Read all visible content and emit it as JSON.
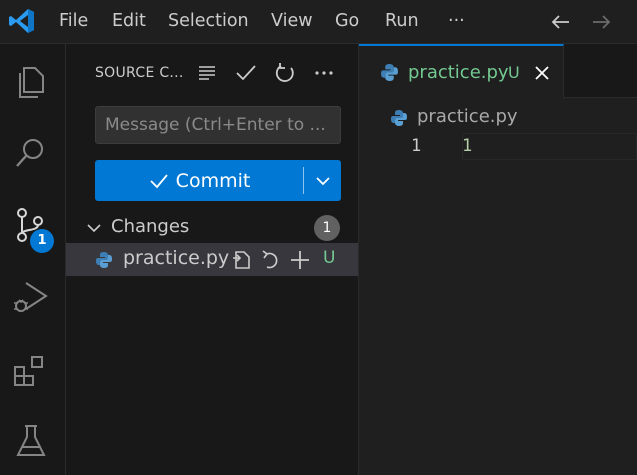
{
  "titlebar": {
    "menu": [
      "File",
      "Edit",
      "Selection",
      "View",
      "Go",
      "Run",
      "···"
    ]
  },
  "activity": {
    "items": [
      {
        "icon": "explorer-icon"
      },
      {
        "icon": "search-icon"
      },
      {
        "icon": "source-control-icon",
        "badge": "1"
      },
      {
        "icon": "run-debug-icon"
      },
      {
        "icon": "extensions-icon"
      },
      {
        "icon": "testing-icon"
      }
    ]
  },
  "scm": {
    "title": "SOURCE C...",
    "message_placeholder": "Message (Ctrl+Enter to ...",
    "commit_label": "Commit",
    "changes_label": "Changes",
    "changes_count": "1",
    "files": [
      {
        "name": "practice.py",
        "status": "U"
      }
    ]
  },
  "editor": {
    "tab": {
      "name": "practice.py",
      "status": "U"
    },
    "breadcrumb": "practice.py",
    "lines": [
      {
        "number": "1",
        "text": "1"
      }
    ]
  },
  "colors": {
    "accent": "#0078d4",
    "untracked": "#73c991",
    "number_literal": "#b5cea8"
  }
}
